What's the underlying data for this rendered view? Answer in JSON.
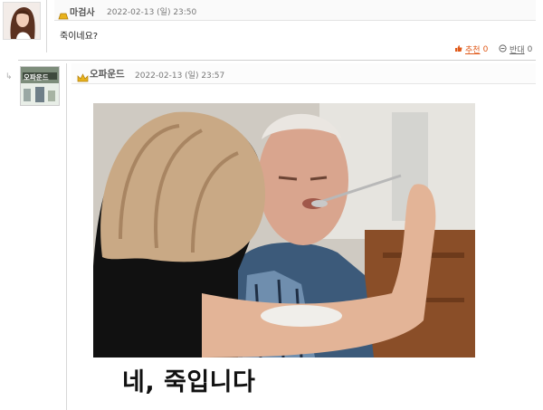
{
  "comments": [
    {
      "nickname": "마검사",
      "date": "2022-02-13 (일) 23:50",
      "text": "죽이네요?",
      "votes": {
        "up_label": "추천",
        "up_count": "0",
        "down_label": "반대",
        "down_count": "0"
      }
    }
  ],
  "reply": {
    "nickname": "오파운드",
    "avatar_text": "오파운드",
    "date": "2022-02-13 (일) 23:57",
    "caption": "네, 죽입니다"
  },
  "icons": {
    "level1": "gold-bar-icon",
    "level2": "crown-icon",
    "thumbs_up": "thumbs-up-icon",
    "thumbs_down": "thumbs-down-icon",
    "reply_arrow": "reply-arrow-icon"
  },
  "colors": {
    "up_vote": "#e05a1a",
    "level_gold": "#e2a010"
  }
}
